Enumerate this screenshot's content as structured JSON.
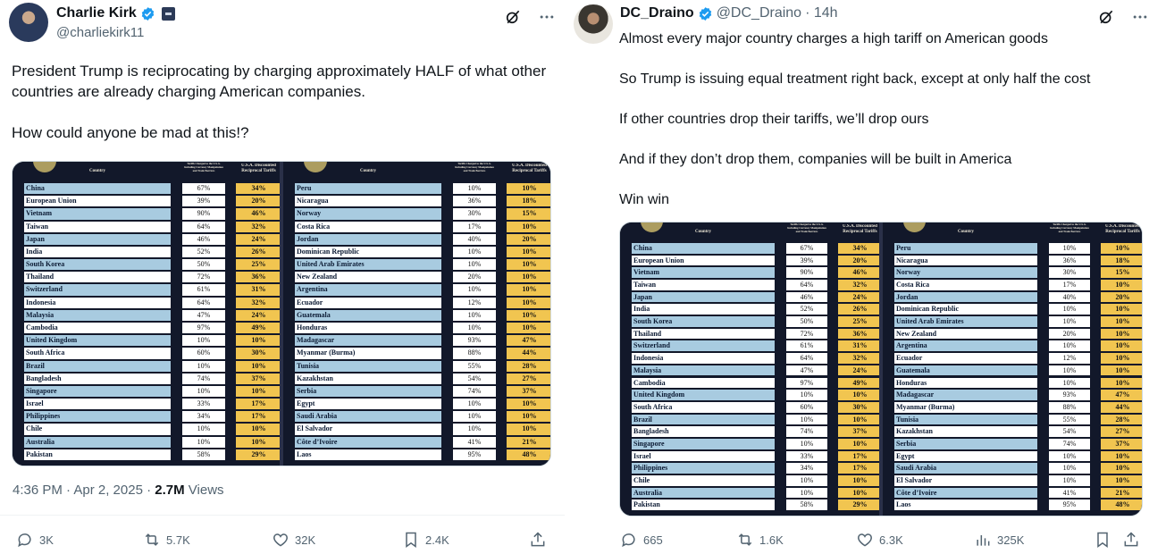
{
  "left": {
    "name": "Charlie Kirk",
    "handle": "@charliekirk11",
    "text": [
      "President Trump is reciprocating by charging approximately HALF of what other countries are already charging American companies.",
      "How could anyone be mad at this!?"
    ],
    "time": "4:36 PM · Apr 2, 2025 · ",
    "views_count": "2.7M",
    "views_label": " Views",
    "stats": {
      "replies": "3K",
      "reposts": "5.7K",
      "likes": "32K",
      "bookmarks": "2.4K"
    }
  },
  "right": {
    "name": "DC_Draino",
    "handle": "@DC_Draino",
    "time": "· 14h",
    "text": [
      "Almost every major country charges a high tariff on American goods",
      "So Trump is issuing equal treatment right back, except at only half the cost",
      "If other countries drop their tariffs, we’ll drop ours",
      "And if they don’t drop them, companies will be built in America",
      "Win win"
    ],
    "stats": {
      "replies": "665",
      "reposts": "1.6K",
      "likes": "6.3K",
      "views": "325K"
    }
  },
  "table": {
    "head_country": "Country",
    "head_charged": "Tariffs Charged to the U.S.A. Including Currency Manipulation and Trade Barriers",
    "head_discounted": "U.S.A. Discounted Reciprocal Tariffs",
    "left_rows": [
      [
        "China",
        "67%",
        "34%"
      ],
      [
        "European Union",
        "39%",
        "20%"
      ],
      [
        "Vietnam",
        "90%",
        "46%"
      ],
      [
        "Taiwan",
        "64%",
        "32%"
      ],
      [
        "Japan",
        "46%",
        "24%"
      ],
      [
        "India",
        "52%",
        "26%"
      ],
      [
        "South Korea",
        "50%",
        "25%"
      ],
      [
        "Thailand",
        "72%",
        "36%"
      ],
      [
        "Switzerland",
        "61%",
        "31%"
      ],
      [
        "Indonesia",
        "64%",
        "32%"
      ],
      [
        "Malaysia",
        "47%",
        "24%"
      ],
      [
        "Cambodia",
        "97%",
        "49%"
      ],
      [
        "United Kingdom",
        "10%",
        "10%"
      ],
      [
        "South Africa",
        "60%",
        "30%"
      ],
      [
        "Brazil",
        "10%",
        "10%"
      ],
      [
        "Bangladesh",
        "74%",
        "37%"
      ],
      [
        "Singapore",
        "10%",
        "10%"
      ],
      [
        "Israel",
        "33%",
        "17%"
      ],
      [
        "Philippines",
        "34%",
        "17%"
      ],
      [
        "Chile",
        "10%",
        "10%"
      ],
      [
        "Australia",
        "10%",
        "10%"
      ],
      [
        "Pakistan",
        "58%",
        "29%"
      ]
    ],
    "right_rows": [
      [
        "Peru",
        "10%",
        "10%"
      ],
      [
        "Nicaragua",
        "36%",
        "18%"
      ],
      [
        "Norway",
        "30%",
        "15%"
      ],
      [
        "Costa Rica",
        "17%",
        "10%"
      ],
      [
        "Jordan",
        "40%",
        "20%"
      ],
      [
        "Dominican Republic",
        "10%",
        "10%"
      ],
      [
        "United Arab Emirates",
        "10%",
        "10%"
      ],
      [
        "New Zealand",
        "20%",
        "10%"
      ],
      [
        "Argentina",
        "10%",
        "10%"
      ],
      [
        "Ecuador",
        "12%",
        "10%"
      ],
      [
        "Guatemala",
        "10%",
        "10%"
      ],
      [
        "Honduras",
        "10%",
        "10%"
      ],
      [
        "Madagascar",
        "93%",
        "47%"
      ],
      [
        "Myanmar (Burma)",
        "88%",
        "44%"
      ],
      [
        "Tunisia",
        "55%",
        "28%"
      ],
      [
        "Kazakhstan",
        "54%",
        "27%"
      ],
      [
        "Serbia",
        "74%",
        "37%"
      ],
      [
        "Egypt",
        "10%",
        "10%"
      ],
      [
        "Saudi Arabia",
        "10%",
        "10%"
      ],
      [
        "El Salvador",
        "10%",
        "10%"
      ],
      [
        "Côte d’Ivoire",
        "41%",
        "21%"
      ],
      [
        "Laos",
        "95%",
        "48%"
      ]
    ]
  },
  "colors": {
    "verified": "#1d9bf0",
    "muted": "#536471",
    "tariff": "#f1c550",
    "country": "#a8cbe0"
  }
}
